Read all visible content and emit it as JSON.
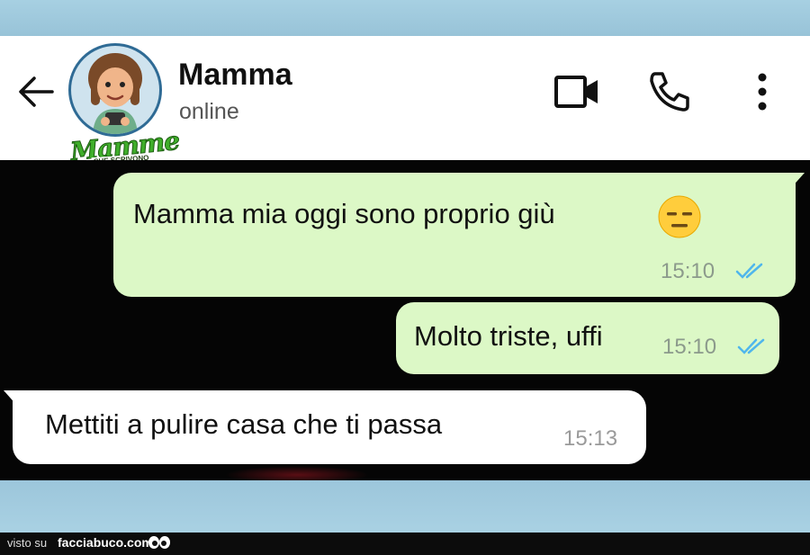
{
  "header": {
    "contact_name": "Mamma",
    "status": "online",
    "brand_word": "Mamme",
    "brand_subtitle": "CHE SCRIVONO MESSAGGI"
  },
  "icons": {
    "back": "arrow-left-icon",
    "video": "video-call-icon",
    "phone": "phone-call-icon",
    "menu": "more-vertical-icon",
    "emoji": "expressionless-face-emoji",
    "read": "double-check-icon"
  },
  "messages": [
    {
      "direction": "outgoing",
      "text": "Mamma mia oggi sono proprio giù",
      "emoji": "😑",
      "time": "15:10",
      "status": "read"
    },
    {
      "direction": "outgoing",
      "text": "Molto triste, uffi",
      "time": "15:10",
      "status": "read"
    },
    {
      "direction": "incoming",
      "text": "Mettiti a pulire casa che ti passa",
      "time": "15:13"
    }
  ],
  "footer": {
    "prefix": "visto su",
    "site": "facciabuco.com"
  },
  "colors": {
    "outgoing_bubble": "#dcf8c6",
    "incoming_bubble": "#ffffff",
    "chat_background": "#050505",
    "read_ticks": "#4fb6ec",
    "frame": "#9fc8dd"
  }
}
